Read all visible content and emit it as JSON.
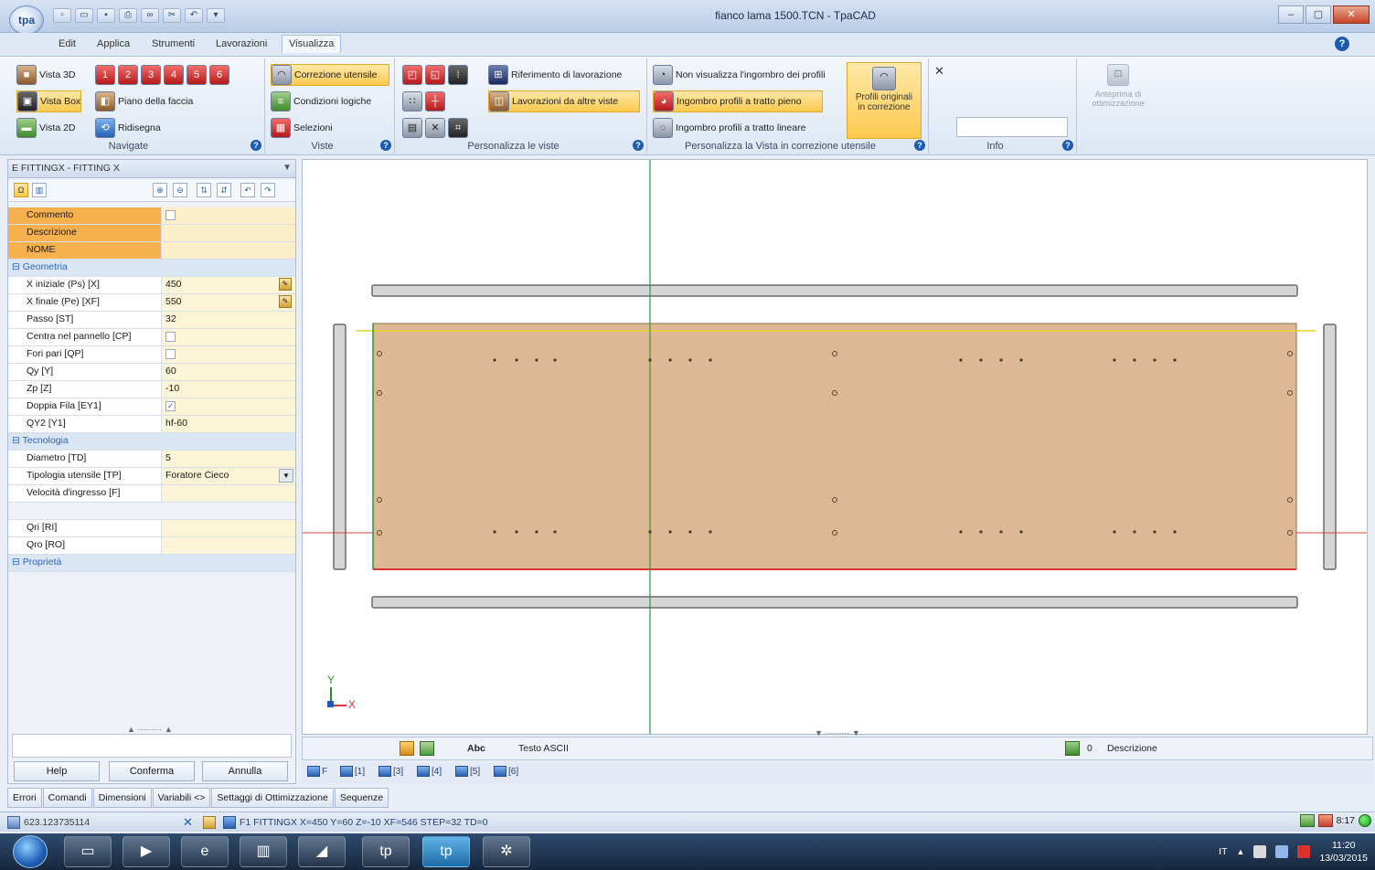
{
  "window": {
    "title": "fianco lama 1500.TCN - TpaCAD",
    "logo": "tpa",
    "controls": [
      "–",
      "▢",
      "✕"
    ]
  },
  "menu": {
    "tabs": [
      "Edit",
      "Applica",
      "Strumenti",
      "Lavorazioni",
      "Visualizza"
    ],
    "active_tab": "Visualizza"
  },
  "ribbon": {
    "navigate": {
      "label": "Navigate",
      "vista3d": "Vista 3D",
      "vistabox": "Vista Box",
      "vista2d": "Vista 2D",
      "piano": "Piano della faccia",
      "ridisegna": "Ridisegna"
    },
    "viste": {
      "label": "Viste",
      "correzione": "Correzione utensile",
      "condizioni": "Condizioni logiche",
      "selezioni": "Selezioni"
    },
    "personalizza": {
      "label": "Personalizza le viste",
      "riferimento": "Riferimento di lavorazione",
      "altre_viste": "Lavorazioni da altre viste"
    },
    "correzione": {
      "label": "Personalizza la Vista in correzione utensile",
      "non_visualizza": "Non visualizza l'ingombro dei profili",
      "pieno": "Ingombro profili a tratto pieno",
      "lineare": "Ingombro profili a tratto lineare",
      "profili_line1": "Profili originali",
      "profili_line2": "in correzione"
    },
    "info": {
      "label": "Info",
      "value": ""
    },
    "anteprima": {
      "line1": "Anteprima di",
      "line2": "ottimizzazione"
    }
  },
  "panel": {
    "title": "E FITTINGX - FITTING X",
    "pin": "▼",
    "rows": [
      {
        "type": "orange",
        "name": "Commento",
        "value": "",
        "check": false
      },
      {
        "type": "orange",
        "name": "Descrizione",
        "value": ""
      },
      {
        "type": "orange",
        "name": "NOME",
        "value": ""
      },
      {
        "type": "cat",
        "name": "Geometria"
      },
      {
        "type": "row",
        "name": "X iniziale (Ps) [X]",
        "value": "450",
        "edit": true
      },
      {
        "type": "row",
        "name": "X finale (Pe) [XF]",
        "value": "550",
        "edit": true
      },
      {
        "type": "row",
        "name": "Passo [ST]",
        "value": "32"
      },
      {
        "type": "row",
        "name": "Centra nel pannello [CP]",
        "value": "",
        "check": false
      },
      {
        "type": "row",
        "name": "Fori pari [QP]",
        "value": "",
        "check": false
      },
      {
        "type": "row",
        "name": "Qy [Y]",
        "value": "60"
      },
      {
        "type": "row",
        "name": "Zp [Z]",
        "value": "-10"
      },
      {
        "type": "row",
        "name": "Doppia Fila [EY1]",
        "value": "",
        "check": true
      },
      {
        "type": "row",
        "name": "QY2 [Y1]",
        "value": "hf-60"
      },
      {
        "type": "cat",
        "name": "Tecnologia"
      },
      {
        "type": "row",
        "name": "Diametro [TD]",
        "value": "5"
      },
      {
        "type": "row",
        "name": "Tipologia utensile [TP]",
        "value": "Foratore Cieco",
        "dropdown": true
      },
      {
        "type": "row",
        "name": "Velocità d'ingresso [F]",
        "value": ""
      },
      {
        "type": "blank",
        "name": "",
        "value": ""
      },
      {
        "type": "row",
        "name": "Qri [RI]",
        "value": ""
      },
      {
        "type": "row",
        "name": "Qro [RO]",
        "value": ""
      },
      {
        "type": "cat",
        "name": "Proprietà"
      }
    ],
    "buttons": {
      "help": "Help",
      "confirm": "Conferma",
      "cancel": "Annulla"
    }
  },
  "drawing": {
    "axis_y": "Y",
    "axis_x": "X"
  },
  "editor": {
    "abc": "Abc",
    "text_mode": "Testo ASCII",
    "zero": "0",
    "description": "Descrizione"
  },
  "faces": [
    "F",
    "[1]",
    "[3]",
    "[4]",
    "[5]",
    "[6]"
  ],
  "tool_tabs": [
    "Errori",
    "Comandi",
    "Dimensioni",
    "Variabili <>",
    "Settaggi di Ottimizzazione",
    "Sequenze"
  ],
  "status": {
    "coords": "623.123735114",
    "message": "F1 FITTINGX X=450 Y=60 Z=-10 XF=546 STEP=32 TD=0",
    "time_small": "8:17"
  },
  "taskbar": {
    "lang": "IT",
    "time": "11:20",
    "date": "13/03/2015"
  },
  "colors": {
    "panel_fill": "#dcb994",
    "accent": "#1d5bb0",
    "highlight": "#fcc94e"
  }
}
